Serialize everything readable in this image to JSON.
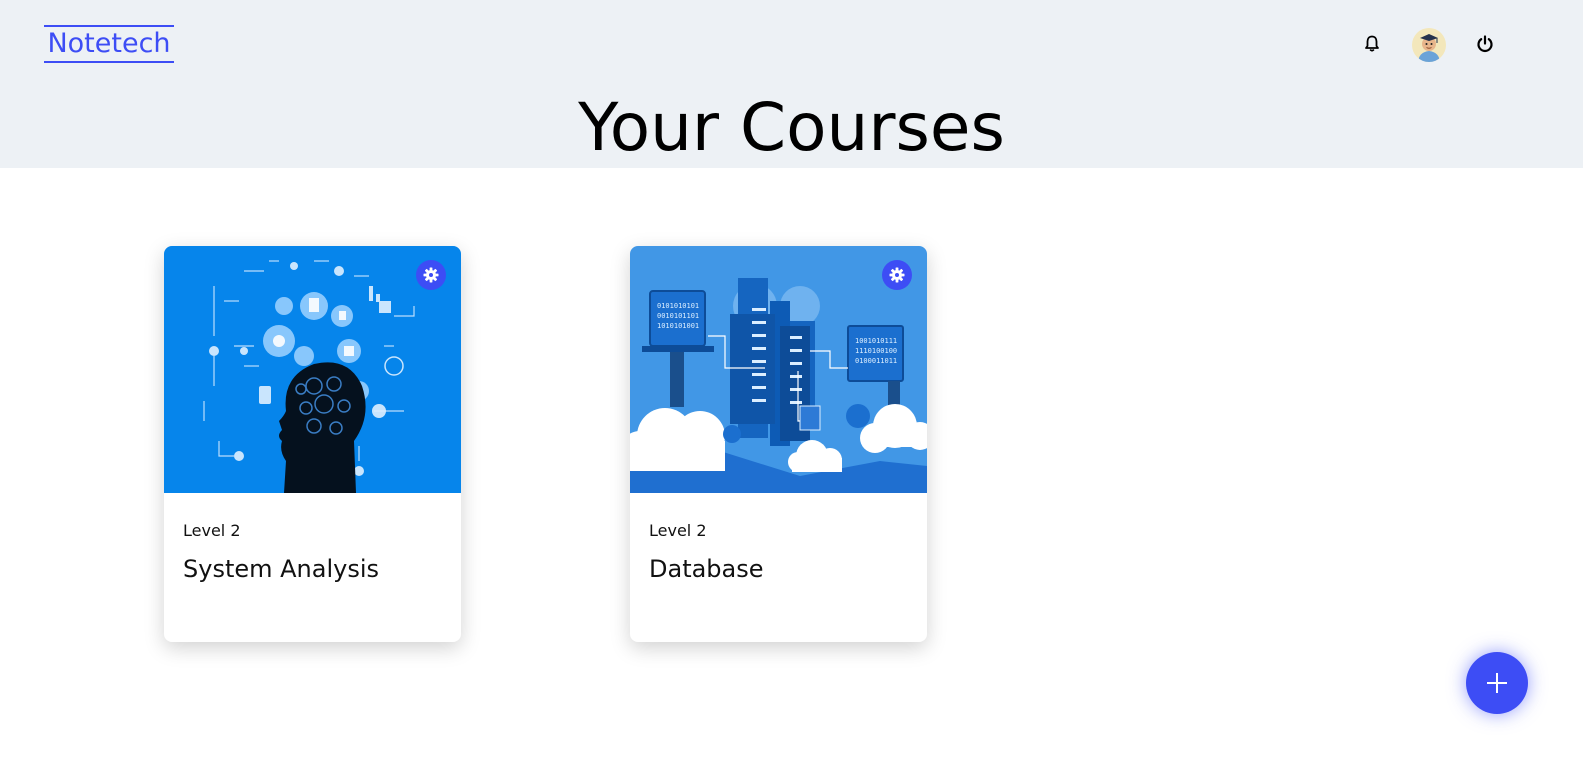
{
  "app": {
    "logo": "Notetech"
  },
  "header": {
    "title": "Your Courses",
    "icons": {
      "notifications": "bell-icon",
      "avatar": "user-avatar",
      "logout": "power-icon"
    }
  },
  "courses": [
    {
      "level": "Level 2",
      "title": "System Analysis",
      "image": "head-network-illustration",
      "settings_icon": "gear-icon"
    },
    {
      "level": "Level 2",
      "title": "Database",
      "image": "cloud-server-illustration",
      "settings_icon": "gear-icon"
    }
  ],
  "fab": {
    "icon": "plus-icon"
  },
  "colors": {
    "accent": "#3d4df5",
    "header_bg": "#edf1f5",
    "card1_bg": "#0a8bef",
    "card2_bg": "#4197e6"
  }
}
